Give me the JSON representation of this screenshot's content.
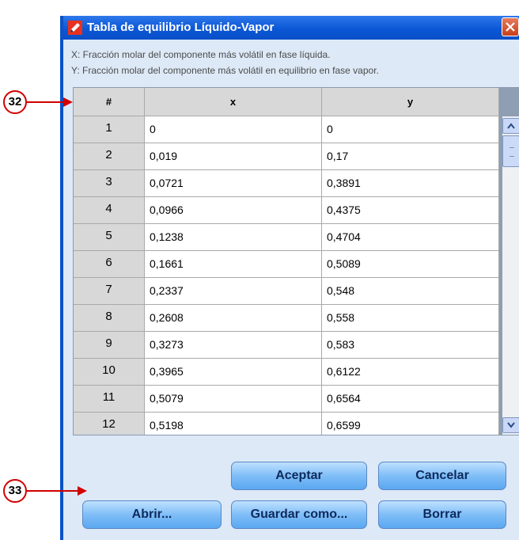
{
  "window": {
    "title": "Tabla de equilibrio Líquido-Vapor",
    "desc_x": "X: Fracción molar del componente más volátil en fase líquida.",
    "desc_y": "Y: Fracción molar del componente más volátil en equilibrio en fase vapor."
  },
  "table": {
    "headers": [
      "#",
      "x",
      "y"
    ],
    "rows": [
      [
        "1",
        "0",
        "0"
      ],
      [
        "2",
        "0,019",
        "0,17"
      ],
      [
        "3",
        "0,0721",
        "0,3891"
      ],
      [
        "4",
        "0,0966",
        "0,4375"
      ],
      [
        "5",
        "0,1238",
        "0,4704"
      ],
      [
        "6",
        "0,1661",
        "0,5089"
      ],
      [
        "7",
        "0,2337",
        "0,548"
      ],
      [
        "8",
        "0,2608",
        "0,558"
      ],
      [
        "9",
        "0,3273",
        "0,583"
      ],
      [
        "10",
        "0,3965",
        "0,6122"
      ],
      [
        "11",
        "0,5079",
        "0,6564"
      ],
      [
        "12",
        "0,5198",
        "0,6599"
      ]
    ]
  },
  "buttons": {
    "accept": "Aceptar",
    "cancel": "Cancelar",
    "open": "Abrir...",
    "save_as": "Guardar como...",
    "clear": "Borrar"
  },
  "annotations": {
    "callout_32": "32",
    "callout_33": "33"
  },
  "colors": {
    "title_bar": "#0b57d6",
    "window_bg": "#dde9f7",
    "header_bg": "#d8d8d8",
    "button": "#7fbef7",
    "callout_border": "#d20000"
  },
  "icons": {
    "app": "pencil-icon",
    "close": "close-icon",
    "scroll_up": "chevron-up-icon",
    "scroll_down": "chevron-down-icon"
  }
}
